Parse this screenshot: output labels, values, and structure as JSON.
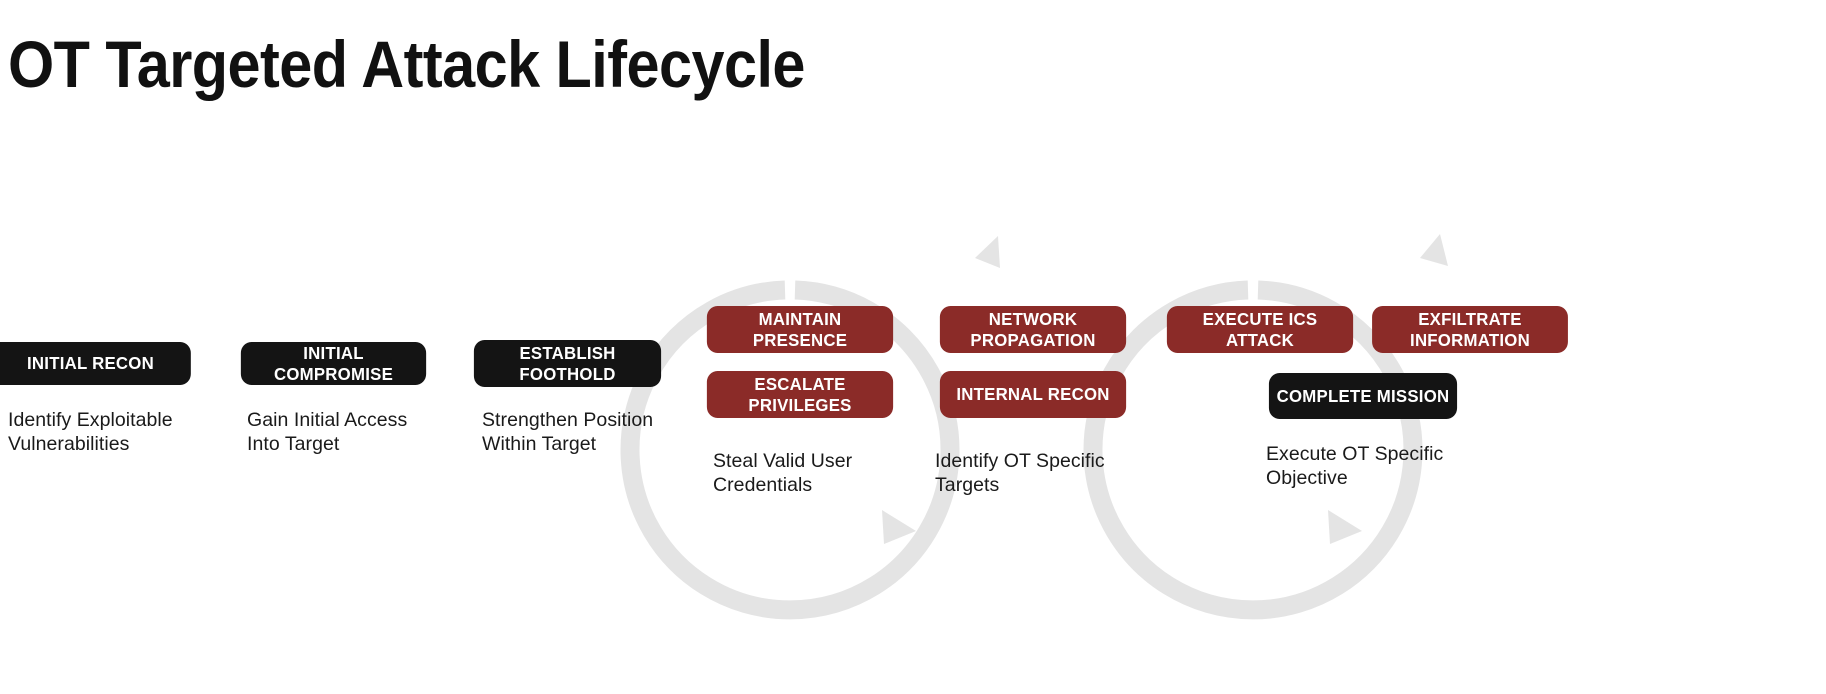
{
  "page": {
    "title": "OT Targeted Attack Lifecycle",
    "background_color": "#FFFFFF"
  },
  "colors": {
    "dark_box": "#141414",
    "red_box": "#8B2B28",
    "arrow_gray": "#E4E4E4",
    "text_dark": "#1A1A1A",
    "text_on_box": "#FFFFFF"
  },
  "stages": [
    {
      "id": "initial-recon",
      "boxes": [
        {
          "label": "INITIAL RECON",
          "style": "dark"
        }
      ],
      "caption": "Identify Exploitable\nVulnerabilities"
    },
    {
      "id": "initial-compromise",
      "boxes": [
        {
          "label": "INITIAL COMPROMISE",
          "style": "dark"
        }
      ],
      "caption": "Gain Initial Access\nInto Target"
    },
    {
      "id": "establish-foothold",
      "boxes": [
        {
          "label": "ESTABLISH\nFOOTHOLD",
          "style": "dark"
        }
      ],
      "caption": "Strengthen Position\nWithin Target"
    },
    {
      "id": "maintain-presence",
      "boxes": [
        {
          "label": "MAINTAIN\nPRESENCE",
          "style": "red"
        },
        {
          "label": "ESCALATE\nPRIVILEGES",
          "style": "red"
        }
      ],
      "caption": "Steal Valid User\nCredentials"
    },
    {
      "id": "network-propagation",
      "boxes": [
        {
          "label": "NETWORK\nPROPAGATION",
          "style": "red"
        },
        {
          "label": "INTERNAL RECON",
          "style": "red"
        }
      ],
      "caption": "Identify  OT Specific\nTargets"
    },
    {
      "id": "execute-ics-attack",
      "boxes": [
        {
          "label": "EXECUTE ICS\nATTACK",
          "style": "red"
        },
        {
          "label": "EXFILTRATE\nINFORMATION",
          "style": "red"
        },
        {
          "label": "COMPLETE MISSION",
          "style": "dark"
        }
      ],
      "caption": "Execute OT Specific\nObjective"
    }
  ],
  "decorations": {
    "loop_arrows": [
      {
        "name": "loop-arrow-left",
        "description": "circular clockwise arrow behind maintain-presence and network-propagation stages"
      },
      {
        "name": "loop-arrow-right",
        "description": "circular clockwise arrow behind execute-ics-attack stage"
      }
    ]
  }
}
